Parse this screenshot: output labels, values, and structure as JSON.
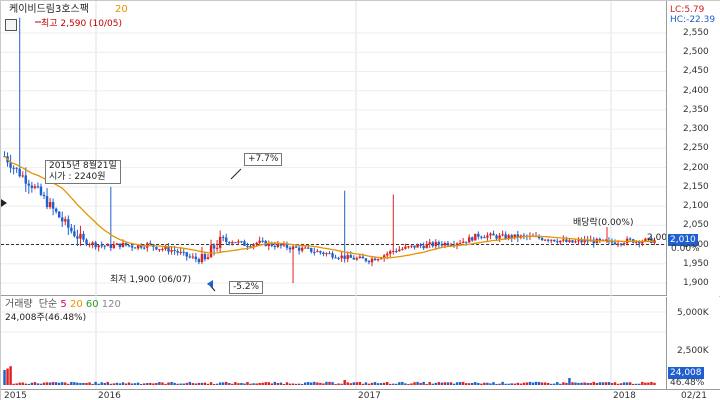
{
  "header": {
    "stock_name": "케이비드림3호스팩",
    "ma_period": "20",
    "lc_label": "LC:5.79",
    "hc_label": "HC:-22.39"
  },
  "annotations": {
    "high": "최고 2,590 (10/05)",
    "low": "최저 1,900 (06/07)",
    "listing_line1": "2015년  8월21일",
    "listing_line2": "시가  :  2240원",
    "up_pct": "+7.7%",
    "down_pct": "-5.2%",
    "dividend": "배당락(0.00%)",
    "ref_price": "2,000"
  },
  "price_axis": {
    "ticks": [
      "2,550",
      "2,500",
      "2,450",
      "2,400",
      "2,350",
      "2,300",
      "2,250",
      "2,200",
      "2,150",
      "2,100",
      "2,050",
      "2,000",
      "1,950",
      "1,900"
    ],
    "current_price": "2,010",
    "current_change": "0.00%"
  },
  "volume_legend": {
    "title": "거래량",
    "type": "단순",
    "periods": [
      "5",
      "20",
      "60",
      "120"
    ],
    "period_colors": [
      "#d6006e",
      "#e59400",
      "#2a9a2a",
      "#888888"
    ],
    "last_volume": "24,008주(46.48%)"
  },
  "volume_axis": {
    "ticks": [
      "5,000K",
      "2,500K"
    ],
    "current_volume": "24,008",
    "current_pct": "46.48%"
  },
  "time_axis": {
    "labels": [
      "2015",
      "2016",
      "2017",
      "2018",
      "02/21"
    ]
  },
  "colors": {
    "up": "#e02020",
    "down": "#1f5fd0",
    "ma": "#e59400",
    "high_marker": "#c00000",
    "current_box": "#1f5fd0"
  },
  "chart_data": {
    "type": "candlestick",
    "title": "",
    "x_range": [
      "2015-08",
      "2018-02-21"
    ],
    "ylim": [
      1880,
      2600
    ],
    "grid": true,
    "high": {
      "value": 2590,
      "date": "10/05"
    },
    "low": {
      "value": 1900,
      "date": "06/07"
    },
    "listing_open": 2240,
    "reference_line": 2000,
    "current": 2010,
    "ma_period": 20,
    "price_path": [
      [
        0,
        2230
      ],
      [
        0.02,
        2190
      ],
      [
        0.04,
        2160
      ],
      [
        0.06,
        2120
      ],
      [
        0.08,
        2080
      ],
      [
        0.1,
        2040
      ],
      [
        0.12,
        2010
      ],
      [
        0.14,
        2000
      ],
      [
        0.16,
        1995
      ],
      [
        0.18,
        2000
      ],
      [
        0.2,
        1995
      ],
      [
        0.22,
        2000
      ],
      [
        0.24,
        1990
      ],
      [
        0.26,
        1985
      ],
      [
        0.28,
        1970
      ],
      [
        0.3,
        1960
      ],
      [
        0.31,
        1955
      ],
      [
        0.32,
        1990
      ],
      [
        0.33,
        2005
      ],
      [
        0.35,
        2010
      ],
      [
        0.37,
        2000
      ],
      [
        0.39,
        2005
      ],
      [
        0.41,
        2000
      ],
      [
        0.43,
        1995
      ],
      [
        0.45,
        1990
      ],
      [
        0.47,
        1985
      ],
      [
        0.5,
        1975
      ],
      [
        0.53,
        1965
      ],
      [
        0.56,
        1960
      ],
      [
        0.58,
        1970
      ],
      [
        0.6,
        1985
      ],
      [
        0.63,
        1995
      ],
      [
        0.66,
        2000
      ],
      [
        0.69,
        2005
      ],
      [
        0.71,
        2010
      ],
      [
        0.73,
        2025
      ],
      [
        0.76,
        2020
      ],
      [
        0.8,
        2020
      ],
      [
        0.84,
        2015
      ],
      [
        0.87,
        2005
      ],
      [
        0.9,
        2010
      ],
      [
        0.93,
        2005
      ],
      [
        0.96,
        2010
      ],
      [
        1.0,
        2010
      ]
    ]
  }
}
